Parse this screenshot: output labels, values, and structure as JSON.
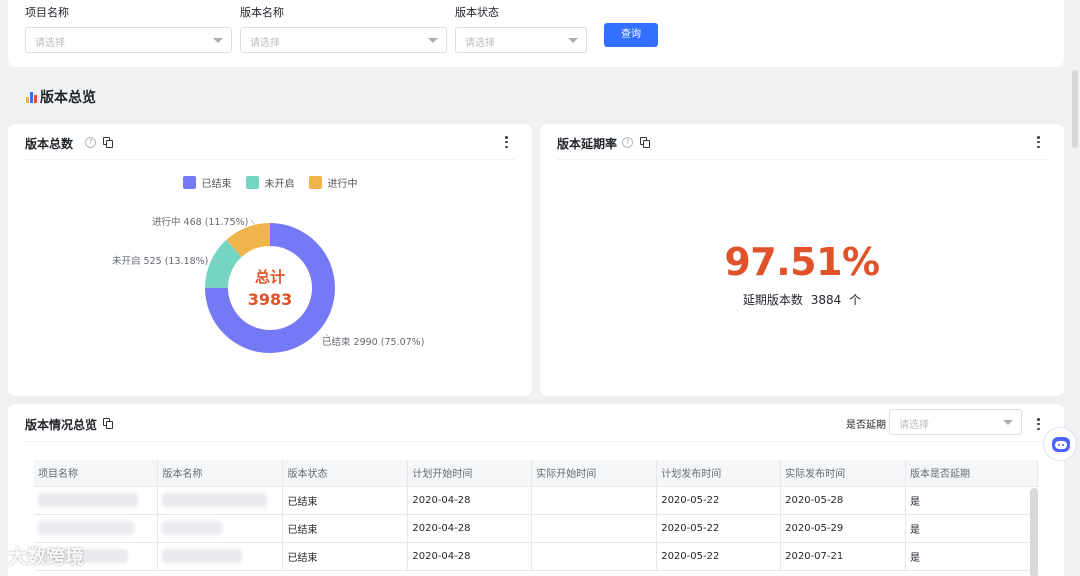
{
  "filters": {
    "project": {
      "label": "项目名称",
      "placeholder": "请选择"
    },
    "version": {
      "label": "版本名称",
      "placeholder": "请选择"
    },
    "status": {
      "label": "版本状态",
      "placeholder": "请选择"
    },
    "query_button": "查询"
  },
  "section_title": "版本总览",
  "total_card": {
    "title": "版本总数",
    "center_label": "总计",
    "center_value": "3983"
  },
  "delay_card": {
    "title": "版本延期率",
    "rate": "97.51%",
    "sub_label": "延期版本数",
    "sub_value": "3884",
    "sub_unit": "个"
  },
  "overview": {
    "title": "版本情况总览",
    "filter_label": "是否延期",
    "filter_placeholder": "请选择",
    "columns": [
      "项目名称",
      "版本名称",
      "版本状态",
      "计划开始时间",
      "实际开始时间",
      "计划发布时间",
      "实际发布时间",
      "版本是否延期"
    ],
    "rows": [
      {
        "status": "已结束",
        "plan_start": "2020-04-28",
        "actual_start": "",
        "plan_release": "2020-05-22",
        "actual_release": "2020-05-28",
        "delayed": "是"
      },
      {
        "status": "已结束",
        "plan_start": "2020-04-28",
        "actual_start": "",
        "plan_release": "2020-05-22",
        "actual_release": "2020-05-29",
        "delayed": "是"
      },
      {
        "status": "已结束",
        "plan_start": "2020-04-28",
        "actual_start": "",
        "plan_release": "2020-05-22",
        "actual_release": "2020-07-21",
        "delayed": "是"
      }
    ]
  },
  "watermark": "大数跨境",
  "colors": {
    "done": "#7579f5",
    "not_started": "#74d5c3",
    "in_progress": "#f0b44c",
    "accent": "#e0532a",
    "primary": "#3370ff"
  },
  "chart_data": {
    "type": "pie",
    "donut": true,
    "categories": [
      "已结束",
      "未开启",
      "进行中"
    ],
    "values": [
      2990,
      525,
      468
    ],
    "percent_labels": [
      "75.07%",
      "13.18%",
      "11.75%"
    ],
    "legend_placement": "top"
  }
}
